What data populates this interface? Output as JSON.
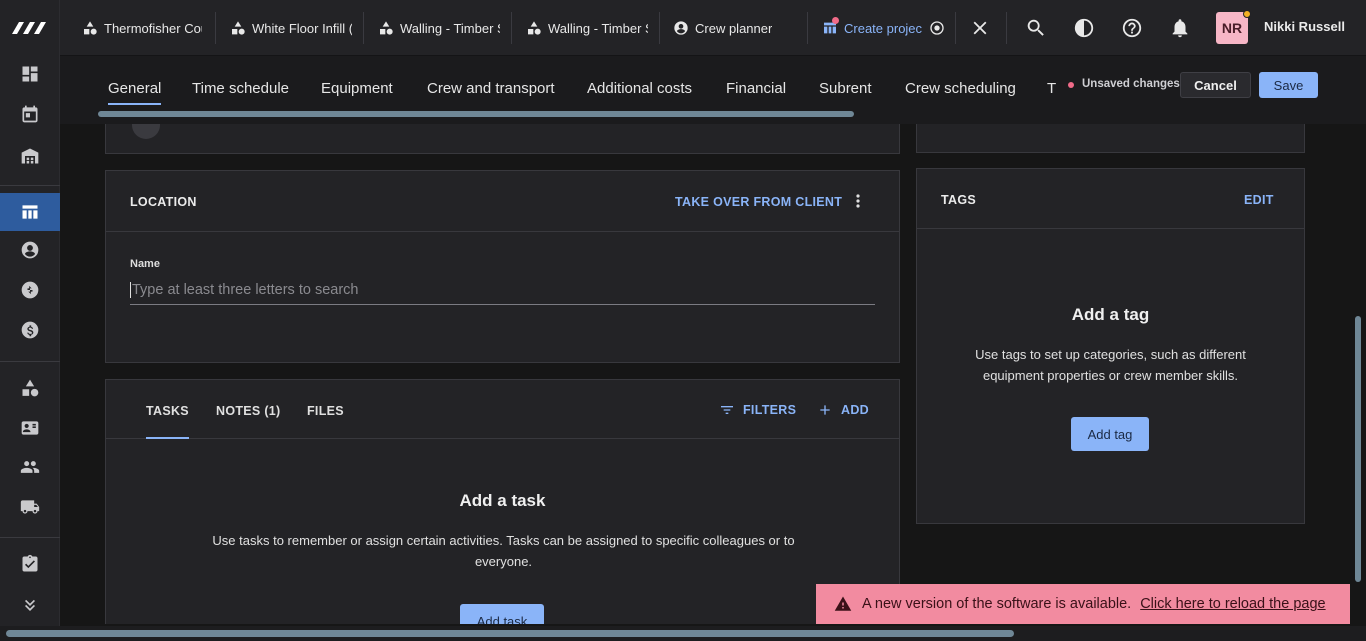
{
  "top_tabs": [
    {
      "label": "Thermofisher Cou",
      "icon": "shapes-icon"
    },
    {
      "label": "White Floor Infill (",
      "icon": "shapes-icon"
    },
    {
      "label": "Walling - Timber S",
      "icon": "shapes-icon"
    },
    {
      "label": "Walling - Timber S",
      "icon": "shapes-icon"
    },
    {
      "label": "Crew planner",
      "icon": "person-circle-icon"
    },
    {
      "label": "Create projec",
      "icon": "project-icon"
    }
  ],
  "user": {
    "initials": "NR",
    "name": "Nikki Russell"
  },
  "sub_tabs": [
    "General",
    "Time schedule",
    "Equipment",
    "Crew and transport",
    "Additional costs",
    "Financial",
    "Subrent",
    "Crew scheduling",
    "T"
  ],
  "actions": {
    "unsaved": "Unsaved changes",
    "cancel": "Cancel",
    "save": "Save"
  },
  "location": {
    "title": "LOCATION",
    "take_over": "TAKE OVER FROM CLIENT",
    "name_label": "Name",
    "name_placeholder": "Type at least three letters to search"
  },
  "tags": {
    "title": "TAGS",
    "edit": "EDIT",
    "empty_title": "Add a tag",
    "empty_text": "Use tags to set up categories, such as different equipment properties or crew member skills.",
    "button": "Add tag"
  },
  "tasks": {
    "tabs": [
      "TASKS",
      "NOTES (1)",
      "FILES"
    ],
    "filters": "FILTERS",
    "add": "ADD",
    "empty_title": "Add a task",
    "empty_text": "Use tasks to remember or assign certain activities. Tasks can be assigned to specific colleagues or to everyone.",
    "button": "Add task"
  },
  "toast": {
    "message": "A new version of the software is available.",
    "link": "Click here to reload the page"
  },
  "colors": {
    "accent": "#8ab4f8",
    "toast": "#f28ba0",
    "active_rail": "#2e5c9e"
  }
}
